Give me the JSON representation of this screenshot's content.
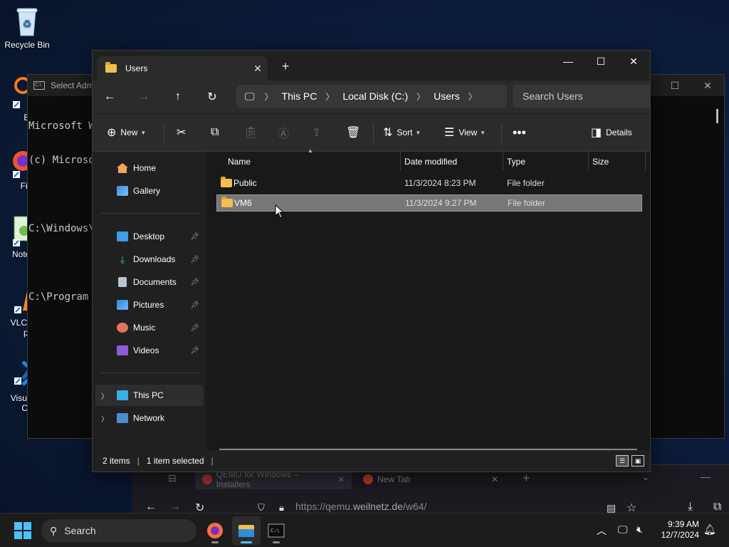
{
  "desktop": {
    "icons": [
      {
        "label": "Recycle Bin"
      },
      {
        "label": "Every"
      },
      {
        "label": "Fire"
      },
      {
        "label": "Notep"
      },
      {
        "label": "VLC m",
        "label2": "pla"
      },
      {
        "label": "Visual",
        "label2": "Co"
      }
    ]
  },
  "console": {
    "title": "Select Adm",
    "lines": [
      "Microsoft W",
      "(c) Microso",
      "",
      "C:\\Windows\\S",
      "",
      "C:\\Program F"
    ]
  },
  "browser": {
    "tabs": [
      {
        "label": "QEMU for Windows – Installers"
      },
      {
        "label": "New Tab"
      }
    ],
    "url_prefix": "https://qemu.",
    "url_domain": "weilnetz.de",
    "url_suffix": "/w64/"
  },
  "explorer": {
    "tab_title": "Users",
    "breadcrumbs": [
      "This PC",
      "Local Disk (C:)",
      "Users"
    ],
    "search_placeholder": "Search Users",
    "commands": {
      "new": "New",
      "sort": "Sort",
      "view": "View",
      "details": "Details"
    },
    "sidebar": {
      "top": [
        {
          "label": "Home"
        },
        {
          "label": "Gallery"
        }
      ],
      "quick": [
        {
          "label": "Desktop"
        },
        {
          "label": "Downloads"
        },
        {
          "label": "Documents"
        },
        {
          "label": "Pictures"
        },
        {
          "label": "Music"
        },
        {
          "label": "Videos"
        }
      ],
      "bottom": [
        {
          "label": "This PC"
        },
        {
          "label": "Network"
        }
      ]
    },
    "columns": [
      "Name",
      "Date modified",
      "Type",
      "Size"
    ],
    "rows": [
      {
        "name": "Public",
        "date": "11/3/2024 8:23 PM",
        "type": "File folder",
        "selected": false
      },
      {
        "name": "VM6",
        "date": "11/3/2024 9:27 PM",
        "type": "File folder",
        "selected": true
      }
    ],
    "status": {
      "items": "2 items",
      "selected": "1 item selected"
    }
  },
  "taskbar": {
    "search": "Search",
    "time": "9:39 AM",
    "date": "12/7/2024"
  },
  "colors": {
    "accent": "#4cc2ff",
    "folder": "#f3c04d",
    "selection": "#777777"
  }
}
